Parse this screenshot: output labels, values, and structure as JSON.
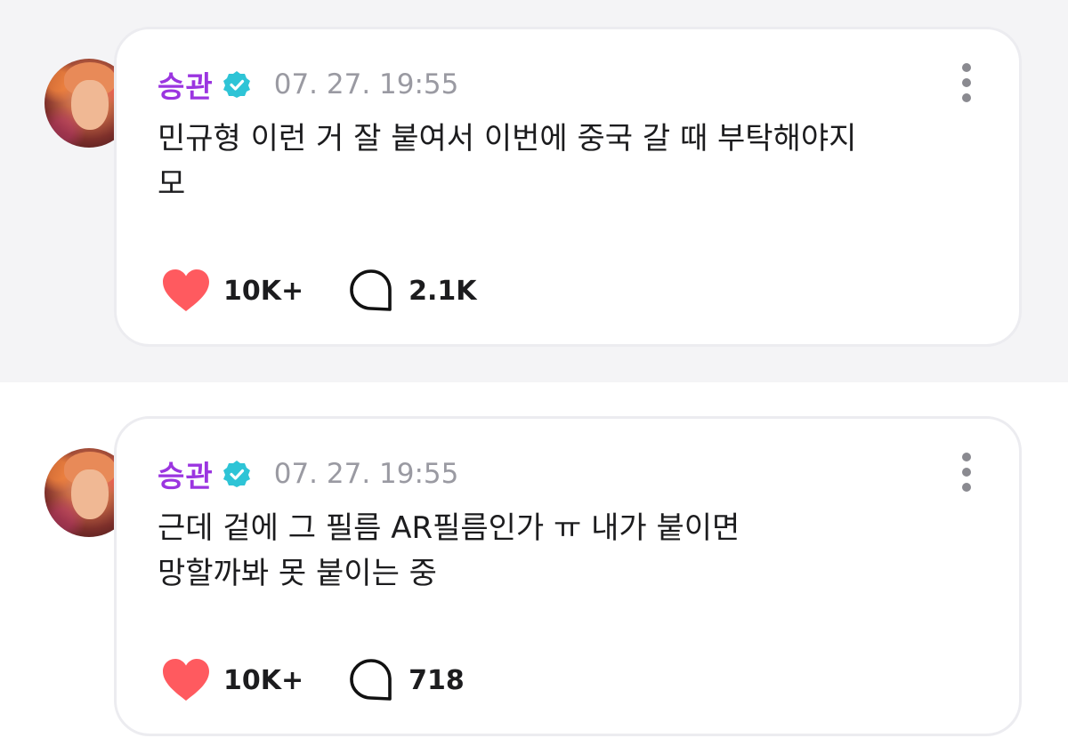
{
  "posts": [
    {
      "author": "승관",
      "timestamp": "07. 27. 19:55",
      "text": "민규형 이런 거 잘 붙여서 이번에 중국 갈 때 부탁해야지\n모",
      "likes": "10K+",
      "comments": "2.1K"
    },
    {
      "author": "승관",
      "timestamp": "07. 27. 19:55",
      "text": "근데 겉에 그 필름 AR필름인가 ㅠ 내가 붙이면\n망할까봐 못 붙이는 중",
      "likes": "10K+",
      "comments": "718"
    }
  ],
  "colors": {
    "author": "#9b35e0",
    "verified_badge": "#2ec4d6",
    "heart": "#ff5a5f",
    "timestamp": "#9a9aa2",
    "top_background": "#f4f4f6"
  },
  "icons": {
    "verified": "verified-badge-icon",
    "menu": "more-vertical-icon",
    "like": "heart-icon",
    "comment": "comment-bubble-icon"
  }
}
